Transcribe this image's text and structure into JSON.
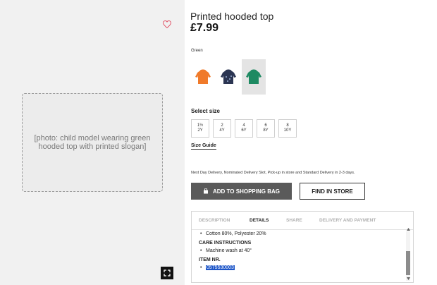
{
  "product": {
    "title": "Printed hooded top",
    "price": "£7.99",
    "color_label": "Green",
    "swatches": [
      {
        "name": "orange",
        "color": "#f07a2a",
        "active": false
      },
      {
        "name": "navy",
        "color": "#2b3552",
        "active": false
      },
      {
        "name": "green",
        "color": "#1e8a62",
        "active": true
      }
    ],
    "size_label": "Select size",
    "sizes": [
      "1½\n2Y",
      "2\n4Y",
      "4\n6Y",
      "6\n8Y",
      "8\n10Y"
    ],
    "size_guide": "Size Guide",
    "delivery_note": "Next Day Delivery, Nominated Delivery Slot, Pick-up in store and Standard Delivery in 2-3 days.",
    "add_to_bag": "ADD TO SHOPPING BAG",
    "find_in_store": "FIND IN STORE"
  },
  "tabs": [
    {
      "label": "DESCRIPTION",
      "active": false
    },
    {
      "label": "DETAILS",
      "active": true
    },
    {
      "label": "SHARE",
      "active": false
    },
    {
      "label": "DELIVERY AND PAYMENT",
      "active": false
    }
  ],
  "details": {
    "composition": "Cotton 80%, Polyester 20%",
    "care_head": "CARE INSTRUCTIONS",
    "care_item": "Machine wash at 40°",
    "item_head": "ITEM NR.",
    "item_number": "0575530003"
  },
  "colors": {
    "button_dark": "#5a5a5a",
    "highlight": "#1e56c8",
    "heart": "#e2566a"
  }
}
